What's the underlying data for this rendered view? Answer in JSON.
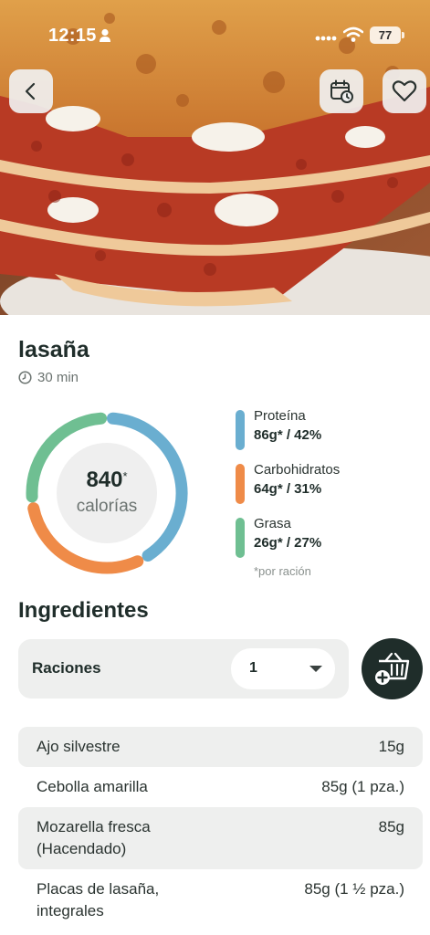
{
  "status_bar": {
    "time": "12:15",
    "battery": "77"
  },
  "recipe": {
    "title": "lasaña",
    "time": "30 min"
  },
  "nutrition": {
    "calories": "840",
    "calories_mark": "*",
    "calories_label": "calorías",
    "per_serving_note": "*por ración",
    "macros": [
      {
        "name": "Proteína",
        "value": "86g* / 42%",
        "percent": 42,
        "color": "#6aaed0"
      },
      {
        "name": "Carbohidratos",
        "value": "64g* / 31%",
        "percent": 31,
        "color": "#ef8b48"
      },
      {
        "name": "Grasa",
        "value": "26g* / 27%",
        "percent": 27,
        "color": "#6fbf92"
      }
    ]
  },
  "ingredients": {
    "title": "Ingredientes",
    "servings_label": "Raciones",
    "servings_value": "1",
    "items": [
      {
        "name_line1": "Ajo silvestre",
        "name_line2": "",
        "qty": "15g"
      },
      {
        "name_line1": "Cebolla amarilla",
        "name_line2": "",
        "qty": "85g (1 pza.)"
      },
      {
        "name_line1": "Mozarella fresca",
        "name_line2": "(Hacendado)",
        "qty": "85g"
      },
      {
        "name_line1": "Placas de lasaña,",
        "name_line2": "integrales",
        "qty": "85g (1 ½ pza.)"
      }
    ]
  },
  "icons": [
    "back-arrow-icon",
    "calendar-clock-icon",
    "heart-icon",
    "clock-icon",
    "basket-add-icon"
  ]
}
